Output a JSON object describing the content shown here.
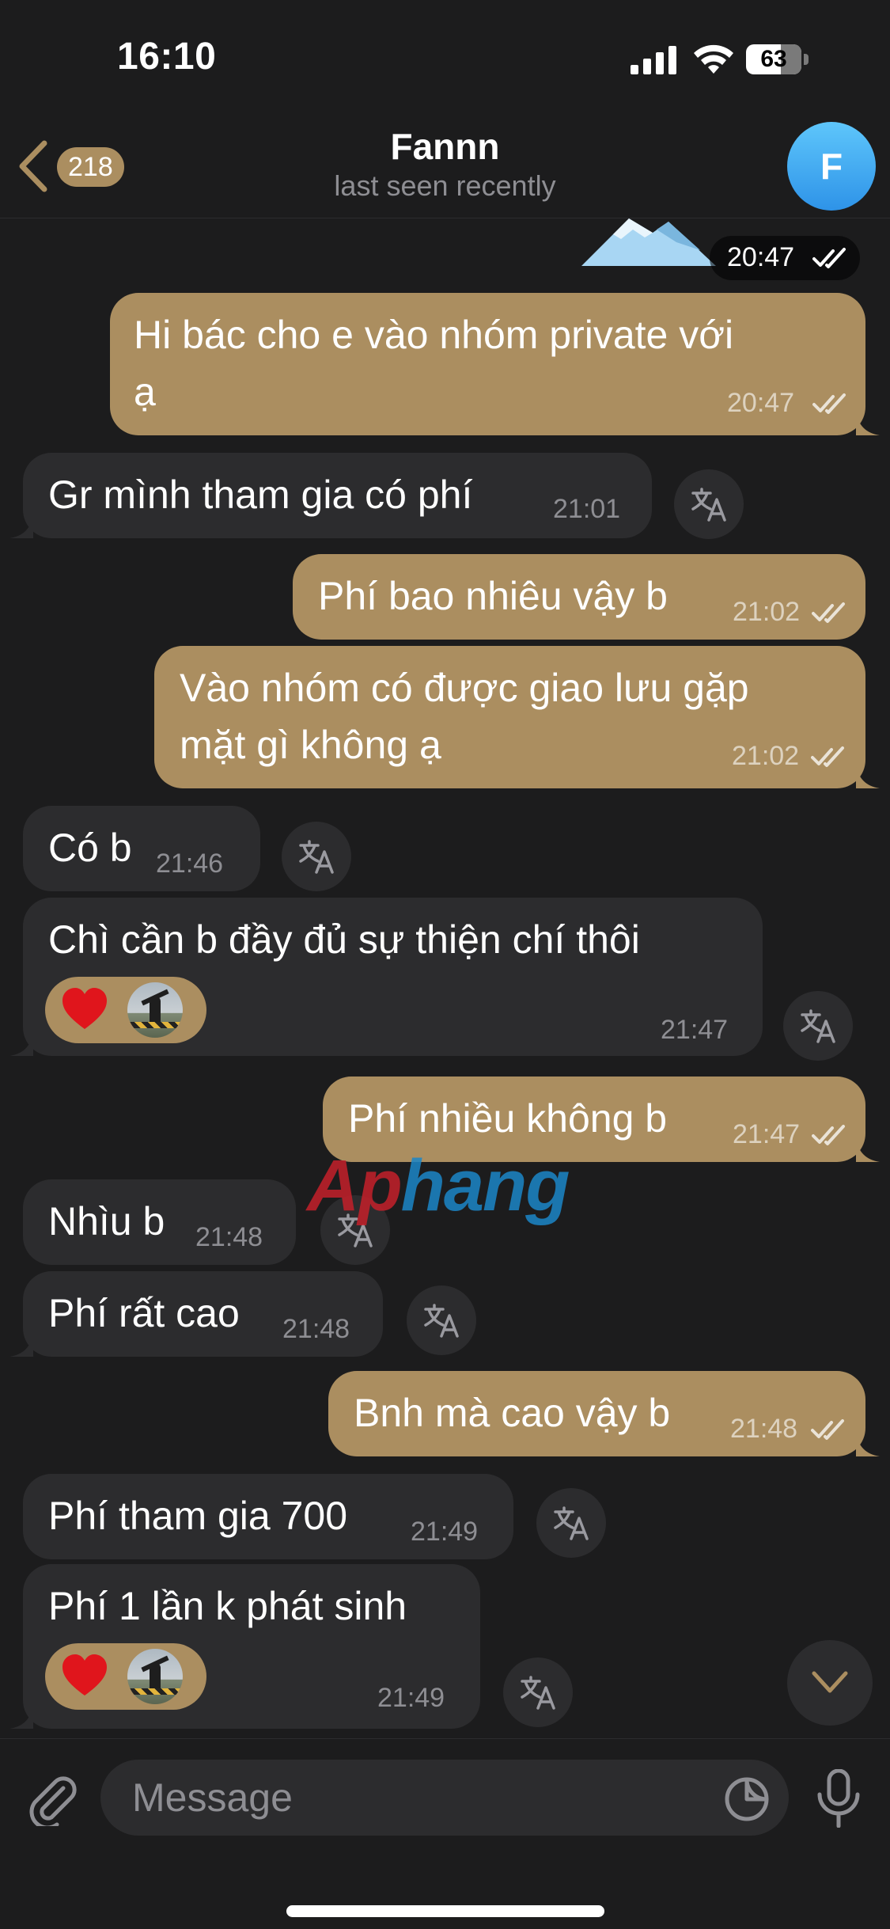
{
  "status_bar": {
    "time": "16:10",
    "battery": "63"
  },
  "header": {
    "back_count": "218",
    "title": "Fannn",
    "subtitle": "last seen recently",
    "avatar_letter": "F"
  },
  "messages": [
    {
      "dir": "out",
      "time": "20:47",
      "media": true
    },
    {
      "dir": "out",
      "lines": [
        "Hi bác cho e vào nhóm private với",
        "ạ"
      ],
      "time": "20:47",
      "read": true
    },
    {
      "dir": "in",
      "lines": [
        "Gr mình tham gia có phí"
      ],
      "time": "21:01"
    },
    {
      "dir": "out",
      "lines": [
        "Phí bao nhiêu vậy b"
      ],
      "time": "21:02",
      "read": true
    },
    {
      "dir": "out",
      "lines": [
        "Vào nhóm có được giao lưu gặp",
        "mặt gì không ạ"
      ],
      "time": "21:02",
      "read": true
    },
    {
      "dir": "in",
      "lines": [
        "Có b"
      ],
      "time": "21:46"
    },
    {
      "dir": "in",
      "lines": [
        "Chì cần b đầy đủ sự thiện chí thôi"
      ],
      "time": "21:47",
      "reactions": [
        "heart",
        "avatar"
      ]
    },
    {
      "dir": "out",
      "lines": [
        "Phí nhiều không b"
      ],
      "time": "21:47",
      "read": true
    },
    {
      "dir": "in",
      "lines": [
        "Nhìu b"
      ],
      "time": "21:48"
    },
    {
      "dir": "in",
      "lines": [
        "Phí rất cao"
      ],
      "time": "21:48"
    },
    {
      "dir": "out",
      "lines": [
        "Bnh mà cao vậy b"
      ],
      "time": "21:48",
      "read": true
    },
    {
      "dir": "in",
      "lines": [
        "Phí tham gia 700"
      ],
      "time": "21:49"
    },
    {
      "dir": "in",
      "lines": [
        "Phí 1 lần k phát sinh"
      ],
      "time": "21:49",
      "reactions": [
        "heart",
        "avatar"
      ]
    }
  ],
  "watermark": {
    "part1": "Ap",
    "part2": "hang"
  },
  "input": {
    "placeholder": "Message"
  },
  "colors": {
    "outgoing_bubble": "#ab8e60",
    "incoming_bubble": "#2c2c2e",
    "background": "#1c1c1d"
  },
  "icons": [
    "back-chevron-icon",
    "translate-icon",
    "heart-reaction-icon",
    "chevron-down-icon",
    "paperclip-icon",
    "sticker-icon",
    "microphone-icon",
    "double-check-icon"
  ]
}
